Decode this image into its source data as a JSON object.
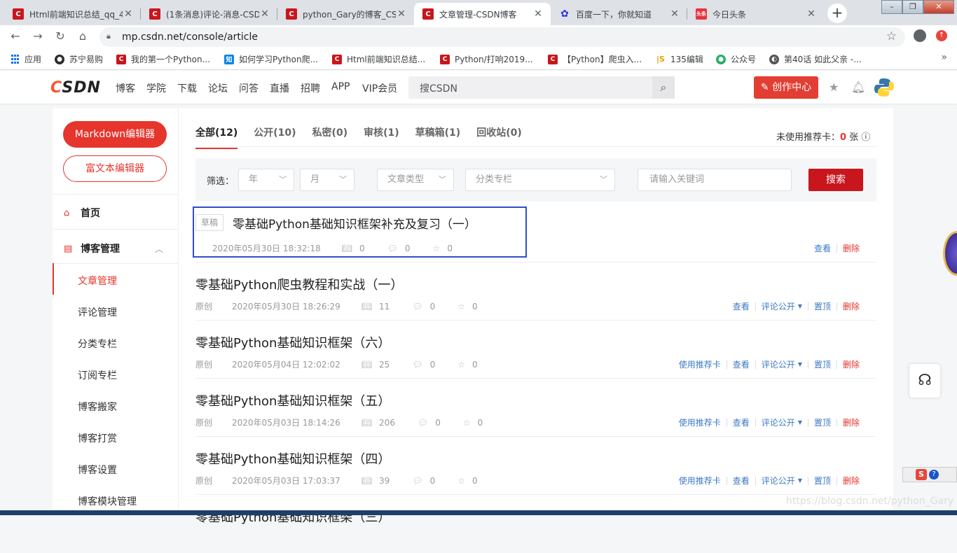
{
  "browser": {
    "tabs": [
      {
        "title": "Html前端知识总结_qq_4",
        "icon": "csdn-favicon",
        "active": false
      },
      {
        "title": "(1条消息)评论-消息-CSD",
        "icon": "csdn-favicon",
        "active": false
      },
      {
        "title": "python_Gary的博客_CS",
        "icon": "csdn-favicon",
        "active": false
      },
      {
        "title": "文章管理-CSDN博客",
        "icon": "csdn-favicon",
        "active": true
      },
      {
        "title": "百度一下，你就知道",
        "icon": "baidu-favicon",
        "active": false
      },
      {
        "title": "今日头条",
        "icon": "toutiao-favicon",
        "active": false
      }
    ],
    "url": "mp.csdn.net/console/article",
    "bookmarks": [
      {
        "label": "应用",
        "icon": "apps-grid-icon"
      },
      {
        "label": "苏宁易购",
        "icon": "suning-icon"
      },
      {
        "label": "我的第一个Python...",
        "icon": "csdn-favicon"
      },
      {
        "label": "如何学习Python爬...",
        "icon": "zhihu-favicon"
      },
      {
        "label": "Html前端知识总结...",
        "icon": "csdn-favicon"
      },
      {
        "label": "Python/打响2019...",
        "icon": "csdn-favicon"
      },
      {
        "label": "【Python】爬虫入...",
        "icon": "csdn-favicon"
      },
      {
        "label": "135编辑",
        "icon": "135-icon"
      },
      {
        "label": "公众号",
        "icon": "wechat-icon"
      },
      {
        "label": "第40话 如此父亲 -...",
        "icon": "globe-icon"
      }
    ]
  },
  "header": {
    "logo": "CSDN",
    "nav": [
      "博客",
      "学院",
      "下载",
      "论坛",
      "问答",
      "直播",
      "招聘",
      "APP",
      "VIP会员"
    ],
    "search_placeholder": "搜CSDN",
    "create_label": "创作中心"
  },
  "sidebar": {
    "markdown_btn": "Markdown编辑器",
    "richtext_btn": "富文本编辑器",
    "home": "首页",
    "blog_manage": "博客管理",
    "items": [
      "文章管理",
      "评论管理",
      "分类专栏",
      "订阅专栏",
      "博客搬家",
      "博客打赏",
      "博客设置",
      "博客模块管理"
    ]
  },
  "main": {
    "tabs": [
      "全部(12)",
      "公开(10)",
      "私密(0)",
      "审核(1)",
      "草稿箱(1)",
      "回收站(0)"
    ],
    "recommend_text": "未使用推荐卡：",
    "recommend_count": "0",
    "recommend_unit": "张",
    "filter": {
      "label": "筛选：",
      "year": "年",
      "month": "月",
      "type": "文章类型",
      "category": "分类专栏",
      "keyword_placeholder": "请输入关键词",
      "search_btn": "搜索"
    },
    "articles": [
      {
        "badge": "草稿",
        "title": "零基础Python基础知识框架补充及复习（一）",
        "type": "",
        "date": "2020年05月30日 18:32:18",
        "views": "0",
        "comments": "0",
        "stars": "0",
        "actions": [
          "查看",
          "删除"
        ]
      },
      {
        "badge": "",
        "title": "零基础Python爬虫教程和实战（一）",
        "type": "原创",
        "date": "2020年05月30日 18:26:29",
        "views": "11",
        "comments": "0",
        "stars": "0",
        "actions": [
          "查看",
          "评论公开",
          "置顶",
          "删除"
        ]
      },
      {
        "badge": "",
        "title": "零基础Python基础知识框架（六）",
        "type": "原创",
        "date": "2020年05月04日 12:02:02",
        "views": "25",
        "comments": "0",
        "stars": "0",
        "actions": [
          "使用推荐卡",
          "查看",
          "评论公开",
          "置顶",
          "删除"
        ]
      },
      {
        "badge": "",
        "title": "零基础Python基础知识框架（五）",
        "type": "原创",
        "date": "2020年05月03日 18:14:26",
        "views": "206",
        "comments": "0",
        "stars": "0",
        "actions": [
          "使用推荐卡",
          "查看",
          "评论公开",
          "置顶",
          "删除"
        ]
      },
      {
        "badge": "",
        "title": "零基础Python基础知识框架（四）",
        "type": "原创",
        "date": "2020年05月03日 17:03:37",
        "views": "39",
        "comments": "0",
        "stars": "0",
        "actions": [
          "使用推荐卡",
          "查看",
          "评论公开",
          "置顶",
          "删除"
        ]
      }
    ],
    "cutoff_title": "零基础Python基础知识框架（三）"
  },
  "watermark": "https://blog.csdn.net/python_Gary"
}
